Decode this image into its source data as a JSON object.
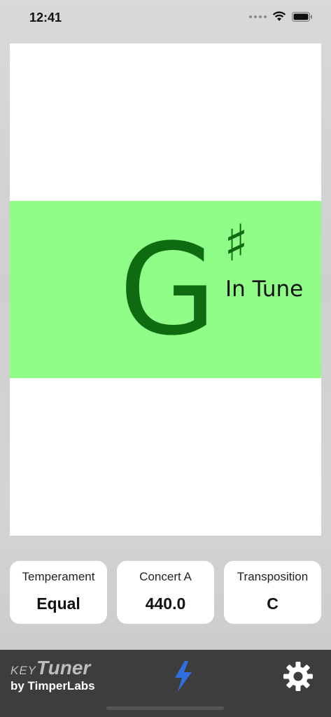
{
  "status_bar": {
    "time": "12:41",
    "icons": [
      "signal-dots-icon",
      "wifi-icon",
      "battery-icon"
    ]
  },
  "tuner": {
    "note": "G",
    "accidental": "♯",
    "status": "In Tune",
    "band_color": "#90fd89",
    "note_color": "#0f6b0f"
  },
  "settings": [
    {
      "label": "Temperament",
      "value": "Equal"
    },
    {
      "label": "Concert A",
      "value": "440.0"
    },
    {
      "label": "Transposition",
      "value": "C"
    }
  ],
  "bottom_bar": {
    "brand_key": "KEY",
    "brand_tuner": "Tuner",
    "brand_byline": "by TimperLabs",
    "accent_color": "#2f6fe0",
    "icons": [
      "bolt-icon",
      "gear-icon"
    ]
  }
}
